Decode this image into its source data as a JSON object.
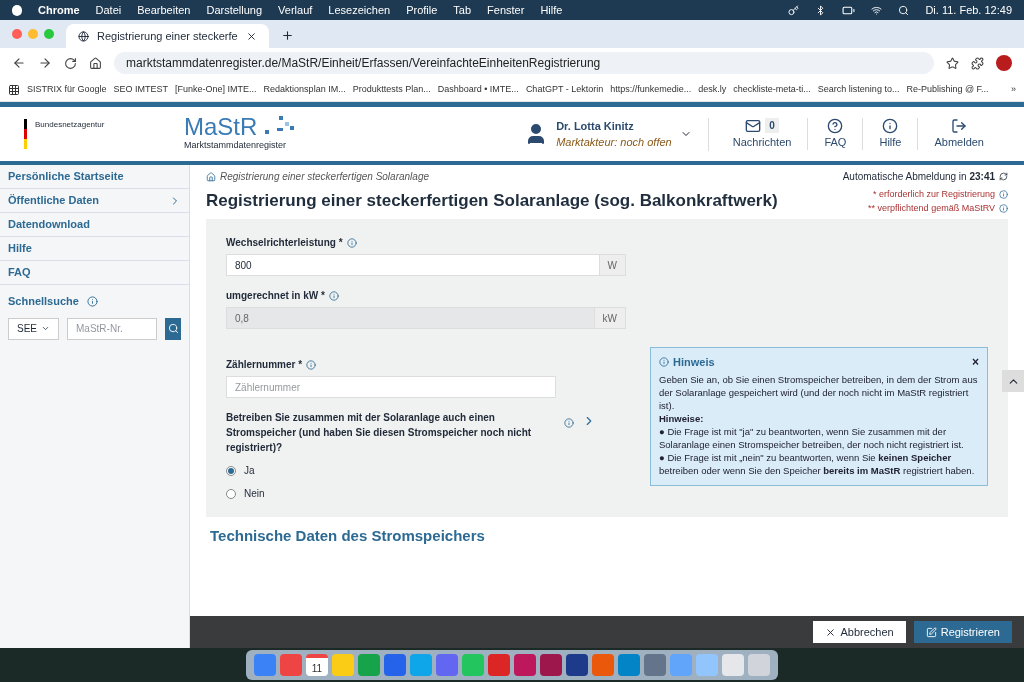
{
  "menubar": {
    "app": "Chrome",
    "items": [
      "Datei",
      "Bearbeiten",
      "Darstellung",
      "Verlauf",
      "Lesezeichen",
      "Profile",
      "Tab",
      "Fenster",
      "Hilfe"
    ],
    "clock": "Di. 11. Feb. 12:49"
  },
  "browser": {
    "tabs": [
      {
        "title": "Registrierung einer steckerfe",
        "selected": true
      }
    ],
    "address": "marktstammdatenregister.de/MaStR/Einheit/Erfassen/VereinfachteEinheitenRegistrierung",
    "bookmarks": [
      "SISTRIX für Google",
      "SEO IMTEST",
      "[Funke-One] IMTE...",
      "Redaktionsplan IM...",
      "Produkttests Plan...",
      "Dashboard • IMTE...",
      "ChatGPT - Lektorin",
      "https://funkemedie...",
      "desk.ly",
      "checkliste-meta-ti...",
      "Search listening to...",
      "Re-Publishing @ F..."
    ],
    "more": "»"
  },
  "header": {
    "agency": "Bundesnetzagentur",
    "logo": "MaStR",
    "logo_subtitle": "Marktstammdatenregister",
    "user_name": "Dr. Lotta Kinitz",
    "user_role": "Marktakteur: noch offen",
    "message_count": "0",
    "nav": [
      {
        "kind": "messages",
        "label": "Nachrichten"
      },
      {
        "kind": "faq",
        "label": "FAQ"
      },
      {
        "kind": "help",
        "label": "Hilfe"
      },
      {
        "kind": "logout",
        "label": "Abmelden"
      }
    ]
  },
  "sidebar": {
    "items": [
      {
        "label": "Persönliche Startseite",
        "has_submenu": false
      },
      {
        "label": "Öffentliche Daten",
        "has_submenu": true
      },
      {
        "label": "Datendownload",
        "has_submenu": false
      },
      {
        "label": "Hilfe",
        "has_submenu": false
      },
      {
        "label": "FAQ",
        "has_submenu": false
      }
    ],
    "quicksearch": {
      "label": "Schnellsuche",
      "select": "SEE",
      "placeholder": "MaStR-Nr."
    }
  },
  "content": {
    "auto_logout": "Automatische Abmeldung in",
    "auto_logout_time": "23:41",
    "breadcrumb": "Registrierung einer steckerfertigen Solaranlage",
    "title": "Registrierung einer steckerfertigen Solaranlage (sog. Balkonkraftwerk)",
    "legend": [
      "* erforderlich zur Registrierung",
      "** verpflichtend gemäß MaStRV"
    ],
    "fields": [
      {
        "label": "Wechselrichterleistung *",
        "value": "800",
        "unit": "W",
        "disabled": false
      },
      {
        "label": "umgerechnet in kW *",
        "value": "0,8",
        "unit": "kW",
        "disabled": true
      }
    ],
    "meter": {
      "label": "Zählernummer *",
      "placeholder": "Zählernummer"
    },
    "question": "Betreiben Sie zusammen mit der Solaranlage auch einen Stromspeicher (und haben Sie diesen Stromspeicher noch nicht registriert)?",
    "options": [
      {
        "label": "Ja",
        "selected": true
      },
      {
        "label": "Nein",
        "selected": false
      }
    ],
    "hint": {
      "title": "Hinweis",
      "close": "×",
      "text": "Geben Sie an, ob Sie einen Stromspeicher betreiben, in dem der Strom aus der Solaranlage gespeichert wird (und der noch nicht im MaStR registriert ist).",
      "subtitle": "Hinweise:",
      "bullets": [
        "● Die Frage ist mit \"ja\" zu beantworten, wenn Sie zusammen mit der Solaranlage einen Stromspeicher betreiben, der noch nicht registriert ist.",
        "● Die Frage ist mit „nein\" zu beantworten, wenn Sie **keinen Speicher** betreiben oder wenn Sie den Speicher **bereits im MaStR** registriert haben."
      ]
    },
    "section": "Technische Daten des Stromspeichers"
  },
  "footer": {
    "cancel": "Abbrechen",
    "submit": "Registrieren"
  },
  "dock": {
    "calendar_day": "11"
  }
}
